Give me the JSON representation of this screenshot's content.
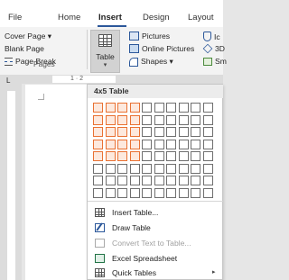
{
  "tabs": [
    {
      "label": "File"
    },
    {
      "label": "Home"
    },
    {
      "label": "Insert",
      "active": true
    },
    {
      "label": "Design"
    },
    {
      "label": "Layout"
    }
  ],
  "ribbon": {
    "pages": {
      "items": [
        "Cover Page ▾",
        "Blank Page",
        "Page Break"
      ],
      "group_label": "Pages"
    },
    "table": {
      "label": "Table",
      "chevron": "▾"
    },
    "illustrations": {
      "items": [
        "Pictures",
        "Online Pictures",
        "Shapes ▾"
      ],
      "cut_items": [
        "Ic",
        "3D",
        "Sm"
      ]
    }
  },
  "ruler": {
    "left_stop": "L",
    "top_ticks": "1 · 2"
  },
  "dropdown": {
    "header": "4x5 Table",
    "grid": {
      "columns": 10,
      "rows": 8,
      "selected_columns": 4,
      "selected_rows": 5
    },
    "menu": [
      {
        "label": "Insert Table...",
        "icon": "table-icon",
        "disabled": false
      },
      {
        "label": "Draw Table",
        "icon": "pencil-icon",
        "disabled": false
      },
      {
        "label": "Convert Text to Table...",
        "icon": "convert-icon",
        "disabled": true
      },
      {
        "label": "Excel Spreadsheet",
        "icon": "excel-icon",
        "disabled": false
      },
      {
        "label": "Quick Tables",
        "icon": "quick-tables-icon",
        "disabled": false,
        "submenu_arrow": "▸"
      }
    ]
  },
  "colors": {
    "accent": "#2b579a",
    "selection_border": "#e97132",
    "selection_fill": "#fde9de"
  }
}
